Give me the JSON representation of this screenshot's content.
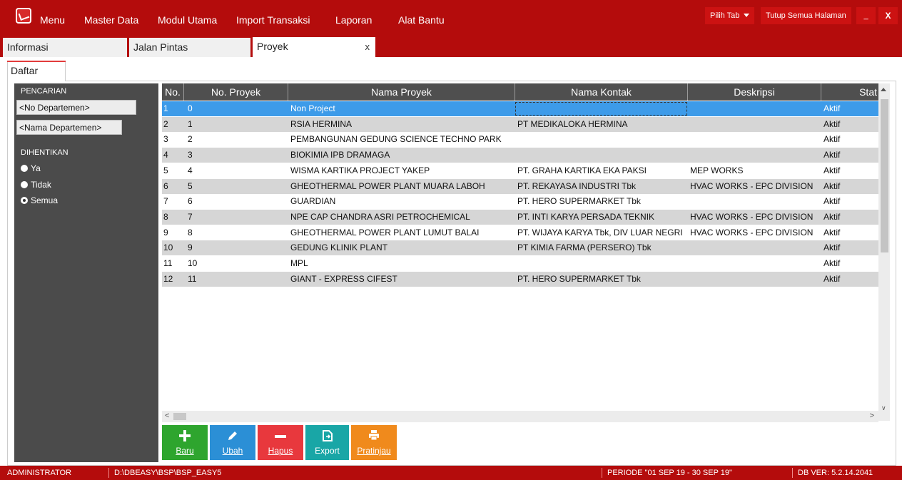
{
  "menubar": {
    "items": [
      "Menu",
      "Master Data",
      "Modul Utama",
      "Import Transaksi",
      "Laporan",
      "Alat Bantu"
    ],
    "pilih_tab": "Pilih Tab",
    "tutup_semua": "Tutup Semua Halaman",
    "minimize": "_",
    "close": "X"
  },
  "tabs": [
    {
      "label": "Informasi",
      "active": false
    },
    {
      "label": "Jalan Pintas",
      "active": false
    },
    {
      "label": "Proyek",
      "active": true,
      "close": "x"
    }
  ],
  "subtab": {
    "label": "Daftar"
  },
  "search_panel": {
    "pencarian_label": "PENCARIAN",
    "no_departemen": "<No Departemen>",
    "nama_departemen": "<Nama Departemen>",
    "dihentikan_label": "DIHENTIKAN",
    "options": [
      {
        "label": "Ya",
        "checked": false
      },
      {
        "label": "Tidak",
        "checked": false
      },
      {
        "label": "Semua",
        "checked": true
      }
    ]
  },
  "grid": {
    "columns": [
      "No.",
      "No. Proyek",
      "Nama Proyek",
      "Nama Kontak",
      "Deskripsi",
      "Stat"
    ],
    "rows": [
      {
        "no": "1",
        "no_proyek": "0",
        "nama_proyek": "Non Project",
        "nama_kontak": "",
        "deskripsi": "",
        "status": "Aktif",
        "selected": true
      },
      {
        "no": "2",
        "no_proyek": "1",
        "nama_proyek": "RSIA HERMINA",
        "nama_kontak": "PT MEDIKALOKA HERMINA",
        "deskripsi": "",
        "status": "Aktif"
      },
      {
        "no": "3",
        "no_proyek": "2",
        "nama_proyek": "PEMBANGUNAN GEDUNG SCIENCE TECHNO PARK",
        "nama_kontak": "",
        "deskripsi": "",
        "status": "Aktif"
      },
      {
        "no": "4",
        "no_proyek": "3",
        "nama_proyek": "BIOKIMIA IPB DRAMAGA",
        "nama_kontak": "",
        "deskripsi": "",
        "status": "Aktif"
      },
      {
        "no": "5",
        "no_proyek": "4",
        "nama_proyek": "WISMA KARTIKA PROJECT YAKEP",
        "nama_kontak": "PT. GRAHA KARTIKA EKA PAKSI",
        "deskripsi": "MEP WORKS",
        "status": "Aktif"
      },
      {
        "no": "6",
        "no_proyek": "5",
        "nama_proyek": "GHEOTHERMAL POWER PLANT MUARA LABOH",
        "nama_kontak": "PT. REKAYASA INDUSTRI Tbk",
        "deskripsi": "HVAC WORKS - EPC DIVISION",
        "status": "Aktif"
      },
      {
        "no": "7",
        "no_proyek": "6",
        "nama_proyek": "GUARDIAN",
        "nama_kontak": "PT. HERO SUPERMARKET Tbk",
        "deskripsi": "",
        "status": "Aktif"
      },
      {
        "no": "8",
        "no_proyek": "7",
        "nama_proyek": "NPE CAP CHANDRA ASRI PETROCHEMICAL",
        "nama_kontak": "PT. INTI KARYA PERSADA TEKNIK",
        "deskripsi": "HVAC WORKS - EPC DIVISION",
        "status": "Aktif"
      },
      {
        "no": "9",
        "no_proyek": "8",
        "nama_proyek": "GHEOTHERMAL POWER PLANT LUMUT BALAI",
        "nama_kontak": "PT. WIJAYA KARYA Tbk, DIV LUAR NEGRI",
        "deskripsi": "HVAC WORKS - EPC DIVISION",
        "status": "Aktif"
      },
      {
        "no": "10",
        "no_proyek": "9",
        "nama_proyek": "GEDUNG KLINIK PLANT",
        "nama_kontak": "PT KIMIA FARMA (PERSERO) Tbk",
        "deskripsi": "",
        "status": "Aktif"
      },
      {
        "no": "11",
        "no_proyek": "10",
        "nama_proyek": "MPL",
        "nama_kontak": "",
        "deskripsi": "",
        "status": "Aktif"
      },
      {
        "no": "12",
        "no_proyek": "11",
        "nama_proyek": "GIANT - EXPRESS CIFEST",
        "nama_kontak": "PT. HERO SUPERMARKET Tbk",
        "deskripsi": "",
        "status": "Aktif"
      }
    ]
  },
  "toolbar": [
    {
      "label": "Baru",
      "icon": "plus-icon",
      "color": "#2ea52e"
    },
    {
      "label": "Ubah",
      "icon": "pencil-icon",
      "color": "#2b8fd6"
    },
    {
      "label": "Hapus",
      "icon": "minus-icon",
      "color": "#e8383d"
    },
    {
      "label": "Export",
      "icon": "export-icon",
      "color": "#19a6a6"
    },
    {
      "label": "Pratinjau",
      "icon": "printer-icon",
      "color": "#f08a1c"
    }
  ],
  "statusbar": {
    "user": "ADMINISTRATOR",
    "path": "D:\\DBEASY\\BSP\\BSP_EASY5",
    "periode": "PERIODE \"01 SEP 19 - 30 SEP 19\"",
    "db_ver": "DB VER: 5.2.14.2041"
  }
}
